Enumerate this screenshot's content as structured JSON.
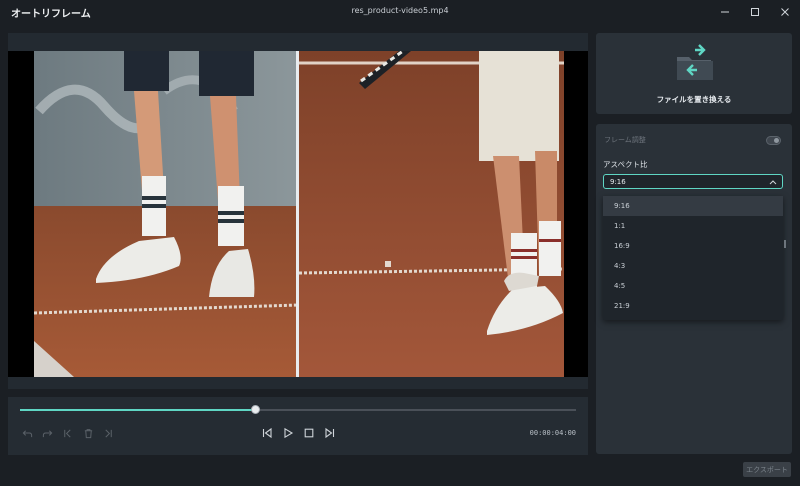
{
  "window": {
    "app_title": "オートリフレーム",
    "file_name": "res_product-video5.mp4",
    "controls": [
      "minimize-icon",
      "maximize-icon",
      "close-icon"
    ]
  },
  "player": {
    "progress_fraction": 0.425,
    "time": "00:00:04:00",
    "buttons": [
      "undo-icon",
      "redo-icon",
      "keyframe-start-icon",
      "delete-icon",
      "keyframe-end-icon",
      "step-back-icon",
      "play-icon",
      "stop-icon",
      "step-forward-icon"
    ]
  },
  "replace": {
    "label": "ファイルを置き換える"
  },
  "settings": {
    "frame_adjust_label": "フレーム調整",
    "aspect_label": "アスペクト比",
    "aspect_value": "9:16",
    "options": [
      "9:16",
      "1:1",
      "16:9",
      "4:3",
      "4:5",
      "21:9"
    ],
    "selected_index": 0
  },
  "export": {
    "label": "エクスポート"
  },
  "colors": {
    "accent": "#5fd6c4",
    "background": "#1b1f24",
    "panel": "#2a3138"
  }
}
